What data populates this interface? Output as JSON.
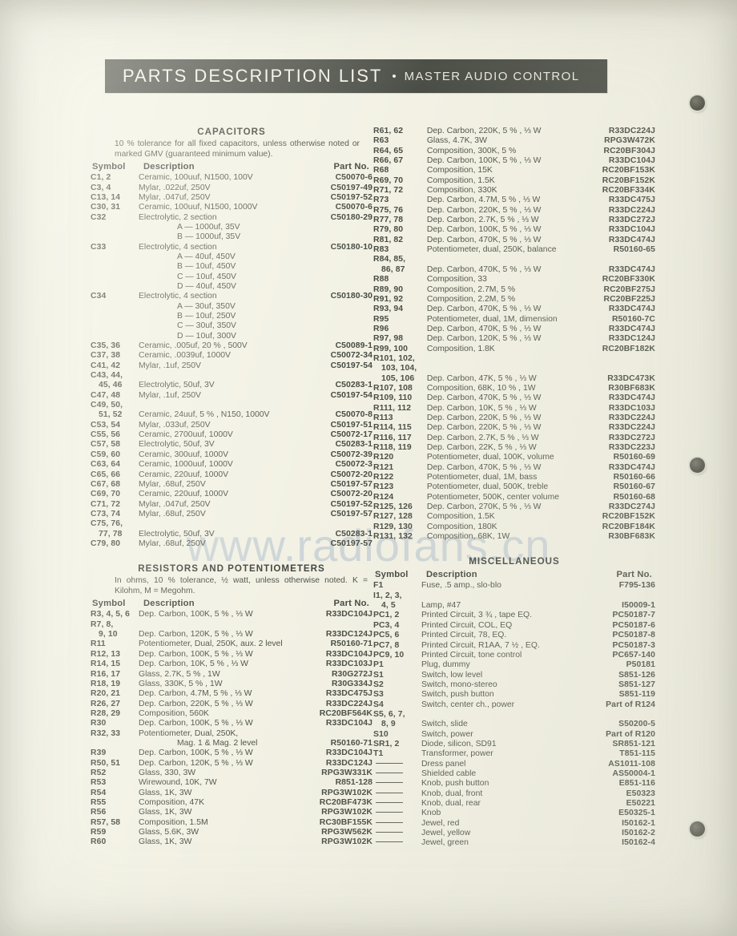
{
  "header": {
    "title": "PARTS DESCRIPTION LIST",
    "separator": "•",
    "subtitle": "MASTER AUDIO CONTROL",
    "bar_color": "#4c4f47",
    "text_color": "#f4f3ea"
  },
  "watermark": {
    "text": "www.radiofans.cn",
    "color": "#96acc4"
  },
  "columns": {
    "headers": {
      "symbol": "Symbol",
      "description": "Description",
      "part_no": "Part No."
    }
  },
  "sections": [
    {
      "id": "capacitors",
      "title": "CAPACITORS",
      "note": "10 % tolerance for all fixed capacitors, unless otherwise noted or marked GMV (guaranteed minimum value).",
      "rows": [
        {
          "symbol": "C1, 2",
          "description": "Ceramic, 100uuf, N1500, 100V",
          "part_no": "C50070-6"
        },
        {
          "symbol": "C3, 4",
          "description": "Mylar, .022uf, 250V",
          "part_no": "C50197-49"
        },
        {
          "symbol": "C13, 14",
          "description": "Mylar, .047uf, 250V",
          "part_no": "C50197-52"
        },
        {
          "symbol": "C30, 31",
          "description": "Ceramic, 100uuf, N1500, 1000V",
          "part_no": "C50070-6"
        },
        {
          "symbol": "C32",
          "description": "Electrolytic, 2 section",
          "part_no": "C50180-29"
        },
        {
          "symbol": "",
          "description": "A — 1000uf, 35V",
          "part_no": "",
          "sub": true
        },
        {
          "symbol": "",
          "description": "B — 1000uf, 35V",
          "part_no": "",
          "sub": true
        },
        {
          "symbol": "C33",
          "description": "Electrolytic, 4 section",
          "part_no": "C50180-10"
        },
        {
          "symbol": "",
          "description": "A — 40uf, 450V",
          "part_no": "",
          "sub": true
        },
        {
          "symbol": "",
          "description": "B — 10uf, 450V",
          "part_no": "",
          "sub": true
        },
        {
          "symbol": "",
          "description": "C — 10uf, 450V",
          "part_no": "",
          "sub": true
        },
        {
          "symbol": "",
          "description": "D — 40uf, 450V",
          "part_no": "",
          "sub": true
        },
        {
          "symbol": "C34",
          "description": "Electrolytic, 4 section",
          "part_no": "C50180-30"
        },
        {
          "symbol": "",
          "description": "A — 30uf, 350V",
          "part_no": "",
          "sub": true
        },
        {
          "symbol": "",
          "description": "B — 10uf, 250V",
          "part_no": "",
          "sub": true
        },
        {
          "symbol": "",
          "description": "C — 30uf, 350V",
          "part_no": "",
          "sub": true
        },
        {
          "symbol": "",
          "description": "D — 10uf, 300V",
          "part_no": "",
          "sub": true
        },
        {
          "symbol": "C35, 36",
          "description": "Ceramic, .005uf, 20 % , 500V",
          "part_no": "C50089-1"
        },
        {
          "symbol": "C37, 38",
          "description": "Ceramic, .0039uf, 1000V",
          "part_no": "C50072-34"
        },
        {
          "symbol": "C41, 42",
          "description": "Mylar, .1uf, 250V",
          "part_no": "C50197-54"
        },
        {
          "symbol": "C43, 44,",
          "description": "",
          "part_no": ""
        },
        {
          "symbol": "45, 46",
          "description": "Electrolytic, 50uf, 3V",
          "part_no": "C50283-1",
          "indent": true
        },
        {
          "symbol": "C47, 48",
          "description": "Mylar, .1uf, 250V",
          "part_no": "C50197-54"
        },
        {
          "symbol": "C49, 50,",
          "description": "",
          "part_no": ""
        },
        {
          "symbol": "51, 52",
          "description": "Ceramic, 24uuf, 5 % , N150, 1000V",
          "part_no": "C50070-8",
          "indent": true
        },
        {
          "symbol": "C53, 54",
          "description": "Mylar, .033uf, 250V",
          "part_no": "C50197-51"
        },
        {
          "symbol": "C55, 56",
          "description": "Ceramic, 2700uuf, 1000V",
          "part_no": "C50072-17"
        },
        {
          "symbol": "C57, 58",
          "description": "Electrolytic, 50uf, 3V",
          "part_no": "C50283-1"
        },
        {
          "symbol": "C59, 60",
          "description": "Ceramic, 300uuf, 1000V",
          "part_no": "C50072-39"
        },
        {
          "symbol": "C63, 64",
          "description": "Ceramic, 1000uuf, 1000V",
          "part_no": "C50072-3"
        },
        {
          "symbol": "C65, 66",
          "description": "Ceramic, 220uuf, 1000V",
          "part_no": "C50072-20"
        },
        {
          "symbol": "C67, 68",
          "description": "Mylar, .68uf, 250V",
          "part_no": "C50197-57"
        },
        {
          "symbol": "C69, 70",
          "description": "Ceramic, 220uuf, 1000V",
          "part_no": "C50072-20"
        },
        {
          "symbol": "C71, 72",
          "description": "Mylar, .047uf, 250V",
          "part_no": "C50197-52"
        },
        {
          "symbol": "C73, 74",
          "description": "Mylar, .68uf, 250V",
          "part_no": "C50197-57"
        },
        {
          "symbol": "C75, 76,",
          "description": "",
          "part_no": ""
        },
        {
          "symbol": "77, 78",
          "description": "Electrolytic, 50uf, 3V",
          "part_no": "C50283-1",
          "indent": true
        },
        {
          "symbol": "C79, 80",
          "description": "Mylar, .68uf, 250V",
          "part_no": "C50197-57"
        }
      ]
    },
    {
      "id": "resistors",
      "title": "RESISTORS AND POTENTIOMETERS",
      "note": "In ohms, 10 % tolerance, ½ watt, unless otherwise noted.  K = Kilohm, M = Megohm.",
      "rows": [
        {
          "symbol": "R3, 4, 5, 6",
          "description": "Dep. Carbon, 100K, 5 % , ⅓ W",
          "part_no": "R33DC104J"
        },
        {
          "symbol": "R7, 8,",
          "description": "",
          "part_no": ""
        },
        {
          "symbol": "9, 10",
          "description": "Dep. Carbon, 120K, 5 % , ⅓ W",
          "part_no": "R33DC124J",
          "indent": true
        },
        {
          "symbol": "R11",
          "description": "Potentiometer, Dual, 250K, aux. 2 level",
          "part_no": "R50160-71"
        },
        {
          "symbol": "R12, 13",
          "description": "Dep. Carbon, 100K, 5 % , ⅓ W",
          "part_no": "R33DC104J"
        },
        {
          "symbol": "R14, 15",
          "description": "Dep. Carbon, 10K, 5 % , ⅓ W",
          "part_no": "R33DC103J"
        },
        {
          "symbol": "R16, 17",
          "description": "Glass, 2.7K, 5 % , 1W",
          "part_no": "R30G272J"
        },
        {
          "symbol": "R18, 19",
          "description": "Glass, 330K, 5 % , 1W",
          "part_no": "R30G334J"
        },
        {
          "symbol": "R20, 21",
          "description": "Dep. Carbon, 4.7M, 5 % , ⅓ W",
          "part_no": "R33DC475J"
        },
        {
          "symbol": "R26, 27",
          "description": "Dep. Carbon, 220K, 5 % , ⅓ W",
          "part_no": "R33DC224J"
        },
        {
          "symbol": "R28, 29",
          "description": "Composition, 560K",
          "part_no": "RC20BF564K"
        },
        {
          "symbol": "R30",
          "description": "Dep. Carbon, 100K, 5 % , ⅓ W",
          "part_no": "R33DC104J"
        },
        {
          "symbol": "R32, 33",
          "description": "Potentiometer, Dual, 250K,",
          "part_no": ""
        },
        {
          "symbol": "",
          "description": "Mag. 1 & Mag. 2 level",
          "part_no": "R50160-71",
          "sub": true
        },
        {
          "symbol": "R39",
          "description": "Dep. Carbon, 100K, 5 % , ⅓ W",
          "part_no": "R33DC104J"
        },
        {
          "symbol": "R50, 51",
          "description": "Dep. Carbon, 120K, 5 % , ⅓ W",
          "part_no": "R33DC124J"
        },
        {
          "symbol": "R52",
          "description": "Glass, 330, 3W",
          "part_no": "RPG3W331K"
        },
        {
          "symbol": "R53",
          "description": "Wirewound, 10K, 7W",
          "part_no": "R851-128"
        },
        {
          "symbol": "R54",
          "description": "Glass, 1K, 3W",
          "part_no": "RPG3W102K"
        },
        {
          "symbol": "R55",
          "description": "Composition, 47K",
          "part_no": "RC20BF473K"
        },
        {
          "symbol": "R56",
          "description": "Glass, 1K, 3W",
          "part_no": "RPG3W102K"
        },
        {
          "symbol": "R57, 58",
          "description": "Composition, 1.5M",
          "part_no": "RC30BF155K"
        },
        {
          "symbol": "R59",
          "description": "Glass, 5.6K, 3W",
          "part_no": "RPG3W562K"
        },
        {
          "symbol": "R60",
          "description": "Glass, 1K, 3W",
          "part_no": "RPG3W102K"
        }
      ]
    },
    {
      "id": "resistors-cont",
      "title": "",
      "note": "",
      "rows": [
        {
          "symbol": "R61, 62",
          "description": "Dep. Carbon, 220K, 5 % , ⅓ W",
          "part_no": "R33DC224J"
        },
        {
          "symbol": "R63",
          "description": "Glass, 4.7K, 3W",
          "part_no": "RPG3W472K"
        },
        {
          "symbol": "R64, 65",
          "description": "Composition, 300K, 5 %",
          "part_no": "RC20BF304J"
        },
        {
          "symbol": "R66, 67",
          "description": "Dep. Carbon, 100K, 5 % , ⅓ W",
          "part_no": "R33DC104J"
        },
        {
          "symbol": "R68",
          "description": "Composition, 15K",
          "part_no": "RC20BF153K"
        },
        {
          "symbol": "R69, 70",
          "description": "Composition, 1.5K",
          "part_no": "RC20BF152K"
        },
        {
          "symbol": "R71, 72",
          "description": "Composition, 330K",
          "part_no": "RC20BF334K"
        },
        {
          "symbol": "R73",
          "description": "Dep. Carbon, 4.7M, 5 % , ⅓ W",
          "part_no": "R33DC475J"
        },
        {
          "symbol": "R75, 76",
          "description": "Dep. Carbon, 220K, 5 % , ⅓ W",
          "part_no": "R33DC224J"
        },
        {
          "symbol": "R77, 78",
          "description": "Dep. Carbon, 2.7K, 5 % , ⅓ W",
          "part_no": "R33DC272J"
        },
        {
          "symbol": "R79, 80",
          "description": "Dep. Carbon, 100K, 5 % , ⅓ W",
          "part_no": "R33DC104J"
        },
        {
          "symbol": "R81, 82",
          "description": "Dep. Carbon, 470K, 5 % , ⅓ W",
          "part_no": "R33DC474J"
        },
        {
          "symbol": "R83",
          "description": "Potentiometer, dual, 250K, balance",
          "part_no": "R50160-65"
        },
        {
          "symbol": "R84, 85,",
          "description": "",
          "part_no": ""
        },
        {
          "symbol": "86, 87",
          "description": "Dep. Carbon, 470K, 5 % , ⅓ W",
          "part_no": "R33DC474J",
          "indent": true
        },
        {
          "symbol": "R88",
          "description": "Composition, 33",
          "part_no": "RC20BF330K"
        },
        {
          "symbol": "R89, 90",
          "description": "Composition, 2.7M, 5 %",
          "part_no": "RC20BF275J"
        },
        {
          "symbol": "R91, 92",
          "description": "Composition, 2.2M, 5 %",
          "part_no": "RC20BF225J"
        },
        {
          "symbol": "R93, 94",
          "description": "Dep. Carbon, 470K, 5 % , ⅓ W",
          "part_no": "R33DC474J"
        },
        {
          "symbol": "R95",
          "description": "Potentiometer, dual, 1M, dimension",
          "part_no": "R50160-7C"
        },
        {
          "symbol": "R96",
          "description": "Dep. Carbon, 470K, 5 % , ⅓ W",
          "part_no": "R33DC474J"
        },
        {
          "symbol": "R97, 98",
          "description": "Dep. Carbon, 120K, 5 % , ⅓ W",
          "part_no": "R33DC124J"
        },
        {
          "symbol": "R99, 100",
          "description": "Composition, 1.8K",
          "part_no": "RC20BF182K"
        },
        {
          "symbol": "R101, 102,",
          "description": "",
          "part_no": ""
        },
        {
          "symbol": "103, 104,",
          "description": "",
          "part_no": "",
          "indent": true
        },
        {
          "symbol": "105, 106",
          "description": "Dep. Carbon, 47K, 5 % , ⅓ W",
          "part_no": "R33DC473K",
          "indent": true
        },
        {
          "symbol": "R107, 108",
          "description": "Composition, 68K, 10 % , 1W",
          "part_no": "R30BF683K"
        },
        {
          "symbol": "R109, 110",
          "description": "Dep. Carbon, 470K, 5 % , ⅓ W",
          "part_no": "R33DC474J"
        },
        {
          "symbol": "R111, 112",
          "description": "Dep. Carbon, 10K, 5 % , ⅓ W",
          "part_no": "R33DC103J"
        },
        {
          "symbol": "R113",
          "description": "Dep. Carbon, 220K, 5 % , ⅓ W",
          "part_no": "R33DC224J"
        },
        {
          "symbol": "R114, 115",
          "description": "Dep. Carbon, 220K, 5 % , ⅓ W",
          "part_no": "R33DC224J"
        },
        {
          "symbol": "R116, 117",
          "description": "Dep. Carbon, 2.7K, 5 % , ⅓ W",
          "part_no": "R33DC272J"
        },
        {
          "symbol": "R118, 119",
          "description": "Dep. Carbon, 22K, 5 % , ⅓ W",
          "part_no": "R33DC223J"
        },
        {
          "symbol": "R120",
          "description": "Potentiometer, dual, 100K, volume",
          "part_no": "R50160-69"
        },
        {
          "symbol": "R121",
          "description": "Dep. Carbon, 470K, 5 % , ⅓ W",
          "part_no": "R33DC474J"
        },
        {
          "symbol": "R122",
          "description": "Potentiometer, dual, 1M, bass",
          "part_no": "R50160-66"
        },
        {
          "symbol": "R123",
          "description": "Potentiometer, dual, 500K, treble",
          "part_no": "R50160-67"
        },
        {
          "symbol": "R124",
          "description": "Potentiometer, 500K, center volume",
          "part_no": "R50160-68"
        },
        {
          "symbol": "R125, 126",
          "description": "Dep. Carbon, 270K, 5 % , ⅓ W",
          "part_no": "R33DC274J"
        },
        {
          "symbol": "R127, 128",
          "description": "Composition, 1.5K",
          "part_no": "RC20BF152K"
        },
        {
          "symbol": "R129, 130",
          "description": "Composition, 180K",
          "part_no": "RC20BF184K"
        },
        {
          "symbol": "R131, 132",
          "description": "Composition, 68K, 1W",
          "part_no": "R30BF683K"
        }
      ]
    },
    {
      "id": "miscellaneous",
      "title": "MISCELLANEOUS",
      "note": "",
      "rows": [
        {
          "symbol": "F1",
          "description": "Fuse, .5 amp., slo-blo",
          "part_no": "F795-136"
        },
        {
          "symbol": "I1, 2, 3,",
          "description": "",
          "part_no": ""
        },
        {
          "symbol": "4, 5",
          "description": "Lamp, #47",
          "part_no": "I50009-1",
          "indent": true
        },
        {
          "symbol": "PC1, 2",
          "description": "Printed Circuit, 3 ¾ , tape EQ.",
          "part_no": "PC50187-7"
        },
        {
          "symbol": "PC3, 4",
          "description": "Printed Circuit, COL, EQ",
          "part_no": "PC50187-6"
        },
        {
          "symbol": "PC5, 6",
          "description": "Printed Circuit, 78, EQ.",
          "part_no": "PC50187-8"
        },
        {
          "symbol": "PC7, 8",
          "description": "Printed Circuit, R1AA, 7 ½ , EQ.",
          "part_no": "PC50187-3"
        },
        {
          "symbol": "PC9, 10",
          "description": "Printed Circuit, tone control",
          "part_no": "PC657-140"
        },
        {
          "symbol": "P1",
          "description": "Plug, dummy",
          "part_no": "P50181"
        },
        {
          "symbol": "S1",
          "description": "Switch, low level",
          "part_no": "S851-126"
        },
        {
          "symbol": "S2",
          "description": "Switch, mono-stereo",
          "part_no": "S851-127"
        },
        {
          "symbol": "S3",
          "description": "Switch, push button",
          "part_no": "S851-119"
        },
        {
          "symbol": "S4",
          "description": "Switch, center ch., power",
          "part_no": "Part of R124"
        },
        {
          "symbol": "S5, 6, 7,",
          "description": "",
          "part_no": ""
        },
        {
          "symbol": "8, 9",
          "description": "Switch, slide",
          "part_no": "S50200-5",
          "indent": true
        },
        {
          "symbol": "S10",
          "description": "Switch, power",
          "part_no": "Part of R120"
        },
        {
          "symbol": "SR1, 2",
          "description": "Diode, silicon, SD91",
          "part_no": "SR851-121"
        },
        {
          "symbol": "T1",
          "description": "Transformer, power",
          "part_no": "T851-115"
        },
        {
          "symbol": "——",
          "description": "Dress panel",
          "part_no": "AS1011-108",
          "dash": true
        },
        {
          "symbol": "——",
          "description": "Shielded cable",
          "part_no": "AS50004-1",
          "dash": true
        },
        {
          "symbol": "——",
          "description": "Knob, push button",
          "part_no": "E851-116",
          "dash": true
        },
        {
          "symbol": "——",
          "description": "Knob, dual, front",
          "part_no": "E50323",
          "dash": true
        },
        {
          "symbol": "——",
          "description": "Knob, dual, rear",
          "part_no": "E50221",
          "dash": true
        },
        {
          "symbol": "——",
          "description": "Knob",
          "part_no": "E50325-1",
          "dash": true
        },
        {
          "symbol": "——",
          "description": "Jewel, red",
          "part_no": "I50162-1",
          "dash": true
        },
        {
          "symbol": "——",
          "description": "Jewel, yellow",
          "part_no": "I50162-2",
          "dash": true
        },
        {
          "symbol": "——",
          "description": "Jewel, green",
          "part_no": "I50162-4",
          "dash": true
        }
      ]
    }
  ]
}
